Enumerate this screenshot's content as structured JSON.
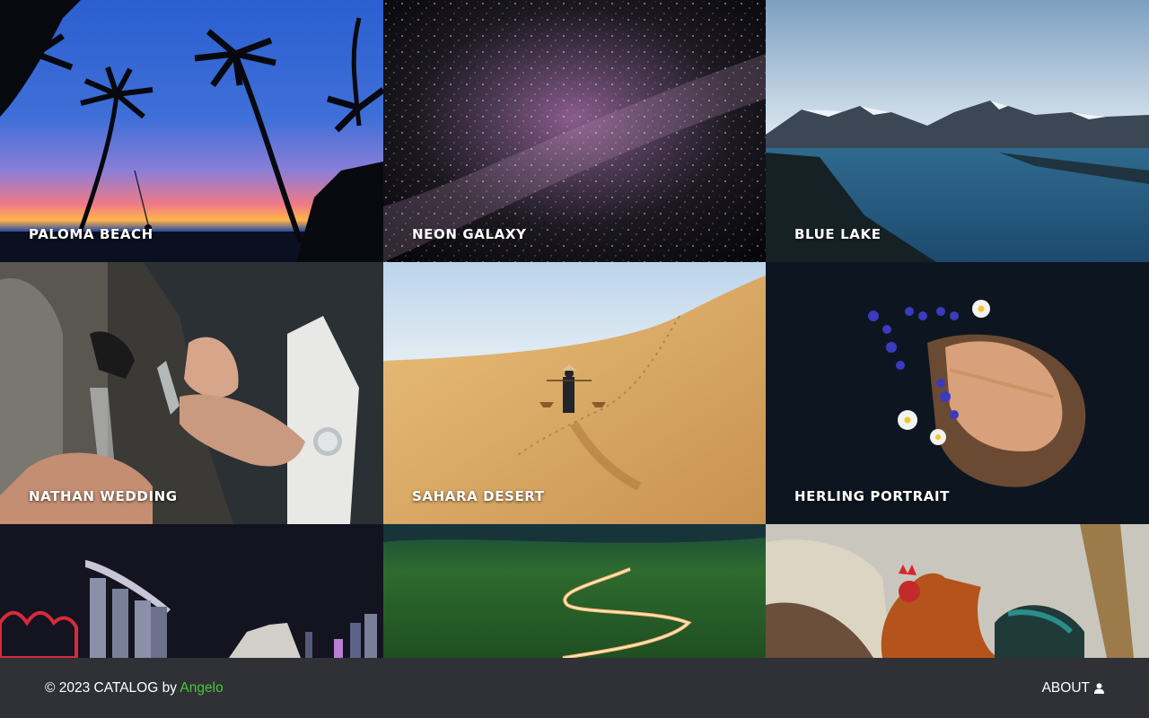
{
  "gallery": {
    "items": [
      {
        "title": "PALOMA BEACH"
      },
      {
        "title": "NEON GALAXY"
      },
      {
        "title": "BLUE LAKE"
      },
      {
        "title": "NATHAN WEDDING"
      },
      {
        "title": "SAHARA DESERT"
      },
      {
        "title": "HERLING PORTRAIT"
      },
      {
        "title": ""
      },
      {
        "title": ""
      },
      {
        "title": ""
      }
    ]
  },
  "footer": {
    "copyright": "© 2023 CATALOG by",
    "author": "Angelo",
    "about_label": "ABOUT",
    "about_icon": "user-icon"
  },
  "colors": {
    "footer_background": "#2f3136",
    "author_link": "#46c93a"
  }
}
